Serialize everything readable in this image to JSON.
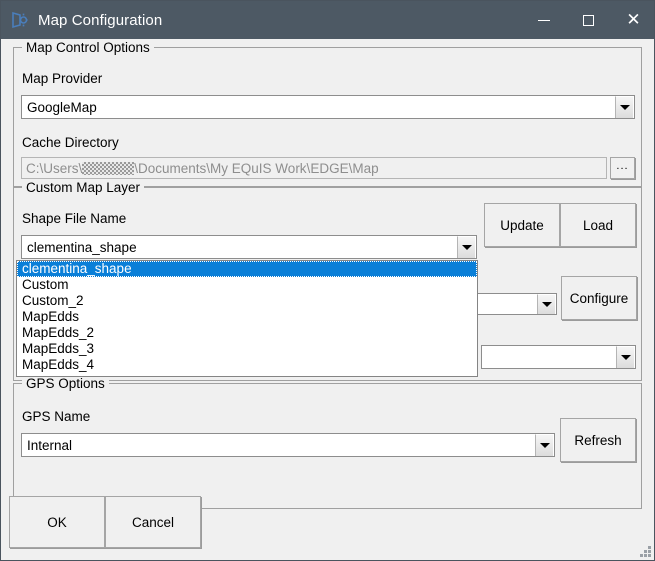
{
  "window": {
    "title": "Map Configuration",
    "icon": "map-configuration-icon",
    "controls": {
      "minimize": "minimize-icon",
      "maximize": "maximize-icon",
      "close": "close-icon"
    },
    "titlebar_color": "#4d5964",
    "client_color": "#f0f0f0",
    "accent_color": "#0a7fd8"
  },
  "map_control_options": {
    "legend": "Map Control Options",
    "map_provider": {
      "label": "Map Provider",
      "value": "GoogleMap"
    },
    "cache_directory": {
      "label": "Cache Directory",
      "value_prefix": "C:\\Users\\",
      "value_suffix": "\\Documents\\My EQuIS Work\\EDGE\\Map",
      "browse_label": "..."
    }
  },
  "custom_map_layer": {
    "legend": "Custom Map Layer",
    "shape_file_name": {
      "label": "Shape File Name",
      "value": "clementina_shape",
      "expanded": true,
      "options": [
        "clementina_shape",
        "Custom",
        "Custom_2",
        "MapEdds",
        "MapEdds_2",
        "MapEdds_3",
        "MapEdds_4"
      ],
      "selected_index": 0
    },
    "update_label": "Update",
    "load_label": "Load",
    "configure_label": "Configure",
    "hidden_combo_1": "",
    "hidden_combo_2": ""
  },
  "gps_options": {
    "legend": "GPS Options",
    "gps_name": {
      "label": "GPS Name",
      "value": "Internal"
    },
    "refresh_label": "Refresh"
  },
  "dialog_buttons": {
    "ok_label": "OK",
    "cancel_label": "Cancel"
  }
}
